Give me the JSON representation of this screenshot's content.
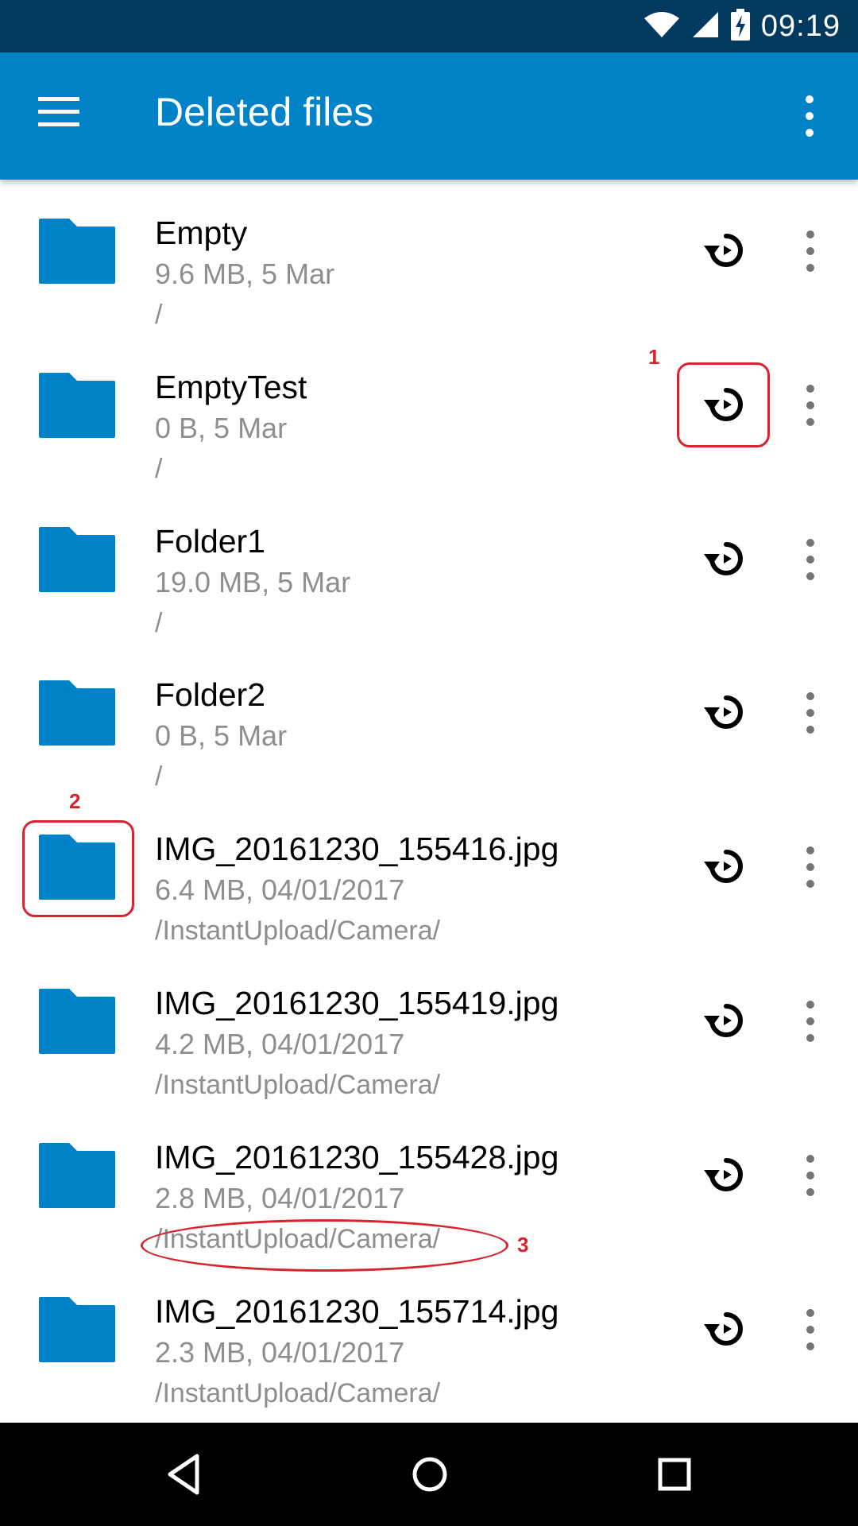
{
  "status_bar": {
    "time": "09:19",
    "icons": [
      "wifi-icon",
      "signal-icon",
      "battery-charging-icon"
    ]
  },
  "app_bar": {
    "title": "Deleted files",
    "menu_icon": "hamburger-menu-icon",
    "overflow_icon": "more-vert-icon"
  },
  "colors": {
    "status_bar": "#01395f",
    "app_bar": "#0082c9",
    "folder": "#0082c9",
    "annotation": "#d9232d",
    "nav_bar": "#000000"
  },
  "files": [
    {
      "name": "Empty",
      "meta": "9.6 MB, 5 Mar",
      "path": "/"
    },
    {
      "name": "EmptyTest",
      "meta": "0 B, 5 Mar",
      "path": "/"
    },
    {
      "name": "Folder1",
      "meta": "19.0 MB, 5 Mar",
      "path": "/"
    },
    {
      "name": "Folder2",
      "meta": "0 B, 5 Mar",
      "path": "/"
    },
    {
      "name": "IMG_20161230_155416.jpg",
      "meta": "6.4 MB, 04/01/2017",
      "path": "/InstantUpload/Camera/"
    },
    {
      "name": "IMG_20161230_155419.jpg",
      "meta": "4.2 MB, 04/01/2017",
      "path": "/InstantUpload/Camera/"
    },
    {
      "name": "IMG_20161230_155428.jpg",
      "meta": "2.8 MB, 04/01/2017",
      "path": "/InstantUpload/Camera/"
    },
    {
      "name": "IMG_20161230_155714.jpg",
      "meta": "2.3 MB, 04/01/2017",
      "path": "/InstantUpload/Camera/"
    }
  ],
  "row_actions": {
    "restore_icon": "restore-icon",
    "more_icon": "more-vert-icon"
  },
  "annotations": [
    "1",
    "2",
    "3"
  ],
  "nav_bar": {
    "back_icon": "back-triangle-icon",
    "home_icon": "home-circle-icon",
    "recents_icon": "recents-square-icon"
  }
}
